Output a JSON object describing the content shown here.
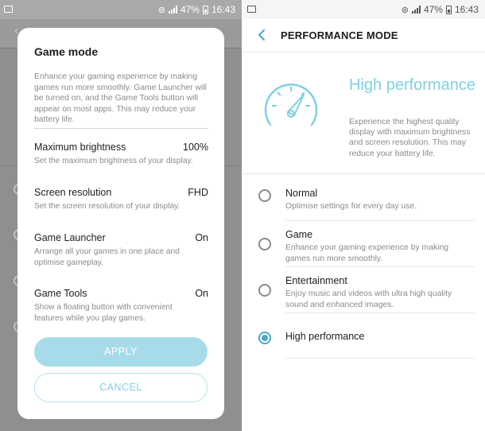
{
  "left_phone": {
    "status_bar": {
      "battery": "47%",
      "time": "16:43"
    },
    "dialog": {
      "title": "Game mode",
      "description": "Enhance your gaming experience by making games run more smoothly. Game Launcher will be turned on, and the Game Tools button will appear on most apps. This may reduce your battery life.",
      "settings": [
        {
          "label": "Maximum brightness",
          "value": "100%",
          "description": "Set the maximum brightness of your display."
        },
        {
          "label": "Screen resolution",
          "value": "FHD",
          "description": "Set the screen resolution of your display."
        },
        {
          "label": "Game Launcher",
          "value": "On",
          "description": "Arrange all your games in one place and optimise gameplay."
        },
        {
          "label": "Game Tools",
          "value": "On",
          "description": "Show a floating button with convenient features while you play games."
        }
      ],
      "apply_label": "APPLY",
      "cancel_label": "CANCEL"
    }
  },
  "right_phone": {
    "status_bar": {
      "battery": "47%",
      "time": "16:43"
    },
    "header": {
      "title": "PERFORMANCE MODE",
      "back_icon": "chevron-left-icon"
    },
    "hero": {
      "icon": "speedometer-icon",
      "title": "High performance",
      "description": "Experience the highest quality display with maximum brightness and screen resolution. This may reduce your battery life."
    },
    "options": [
      {
        "label": "Normal",
        "description": "Optimise settings for every day use.",
        "selected": false
      },
      {
        "label": "Game",
        "description": "Enhance your gaming experience by making games run more smoothly.",
        "selected": false
      },
      {
        "label": "Entertainment",
        "description": "Enjoy music and videos with ultra high quality sound and enhanced images.",
        "selected": false
      },
      {
        "label": "High performance",
        "description": "",
        "selected": true
      }
    ]
  },
  "colors": {
    "accent": "#4aa8c8",
    "hero_title": "#7fd0e4",
    "apply_button": "#a8dbe9",
    "dim_overlay": "#8f8f8f"
  }
}
